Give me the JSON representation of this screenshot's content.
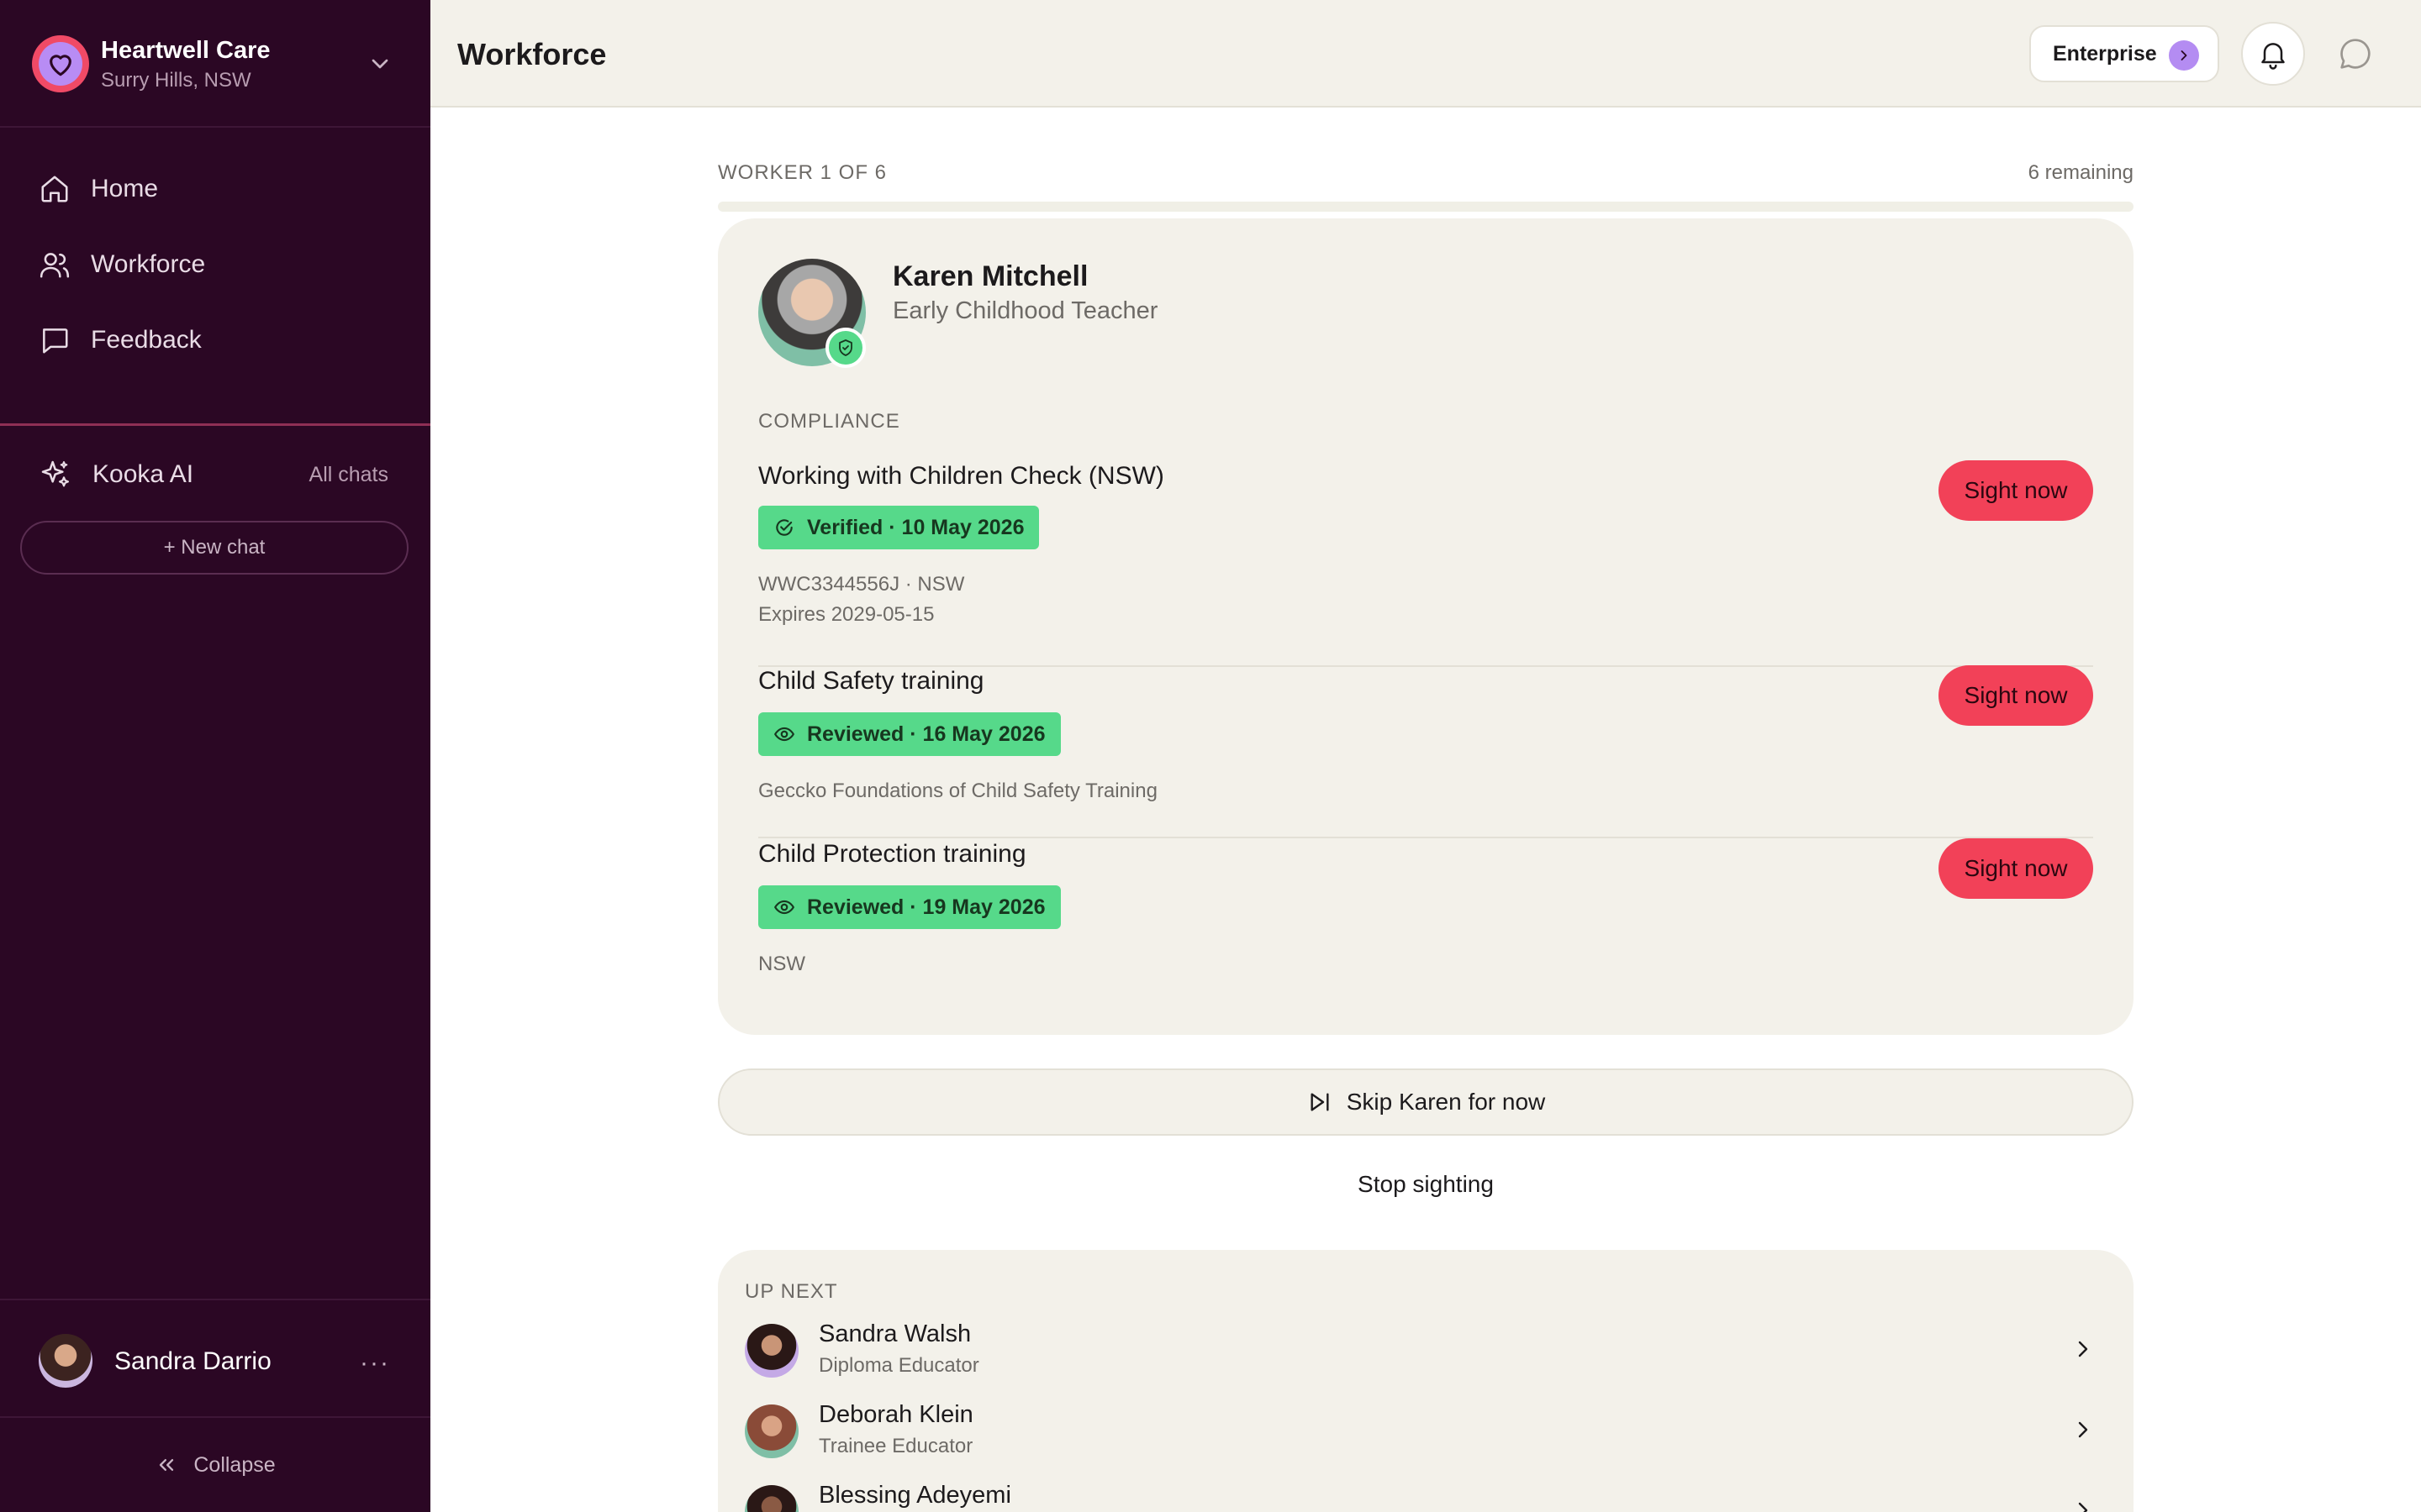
{
  "org": {
    "name": "Heartwell Care",
    "location": "Surry Hills, NSW"
  },
  "nav": {
    "items": [
      {
        "label": "Home",
        "icon": "home-icon"
      },
      {
        "label": "Workforce",
        "icon": "users-icon"
      },
      {
        "label": "Feedback",
        "icon": "message-square-icon"
      }
    ]
  },
  "ai": {
    "label": "Kooka AI",
    "all_chats": "All chats",
    "new_chat": "+ New chat"
  },
  "user": {
    "name": "Sandra Darrio",
    "more": "···"
  },
  "sidebar_footer": {
    "collapse": "Collapse"
  },
  "header": {
    "title": "Workforce",
    "enterprise": "Enterprise"
  },
  "progress": {
    "worker_label": "WORKER 1 OF 6",
    "remaining": "6 remaining",
    "fraction": 0.0
  },
  "worker": {
    "name": "Karen Mitchell",
    "role": "Early Childhood Teacher"
  },
  "compliance": {
    "label": "COMPLIANCE",
    "items": [
      {
        "title": "Working with Children Check (NSW)",
        "status": "Verified · 10 May 2026",
        "status_icon": "check-circle-icon",
        "details": [
          "WWC3344556J · NSW",
          "Expires 2029-05-15"
        ],
        "action": "Sight now"
      },
      {
        "title": "Child Safety training",
        "status": "Reviewed · 16 May 2026",
        "status_icon": "eye-icon",
        "details": [
          "Geccko Foundations of Child Safety Training"
        ],
        "action": "Sight now"
      },
      {
        "title": "Child Protection training",
        "status": "Reviewed · 19 May 2026",
        "status_icon": "eye-icon",
        "details": [
          "NSW"
        ],
        "action": "Sight now"
      }
    ]
  },
  "actions": {
    "skip": "Skip Karen for now",
    "stop": "Stop sighting"
  },
  "up_next": {
    "label": "UP NEXT",
    "workers": [
      {
        "name": "Sandra Walsh",
        "role": "Diploma Educator"
      },
      {
        "name": "Deborah Klein",
        "role": "Trainee Educator"
      },
      {
        "name": "Blessing Adeyemi",
        "role": ""
      }
    ]
  },
  "colors": {
    "sidebar_bg": "#2b0724",
    "accent_red": "#f24158",
    "status_green": "#56d98a",
    "enterprise_purple": "#b48cf2",
    "card_bg": "#f3f1ea"
  }
}
